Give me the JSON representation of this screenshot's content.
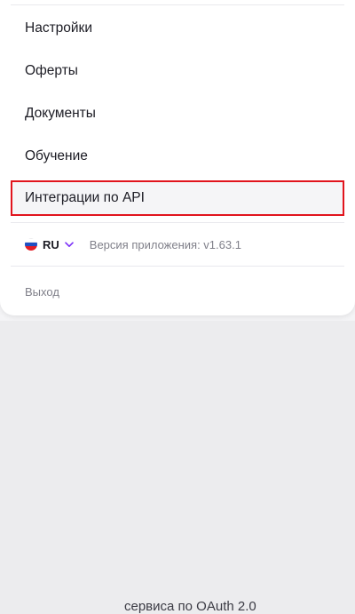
{
  "menu": {
    "items": [
      {
        "label": "Настройки"
      },
      {
        "label": "Оферты"
      },
      {
        "label": "Документы"
      },
      {
        "label": "Обучение"
      },
      {
        "label": "Интеграции по API"
      }
    ]
  },
  "footer": {
    "language": "RU",
    "language_icon": "ru-flag-icon",
    "version_text": "Версия приложения: v1.63.1",
    "logout_label": "Выход"
  },
  "background": {
    "partial_text": "сервиса по OAuth 2.0"
  },
  "colors": {
    "highlight_border": "#e1141d",
    "chevron": "#7b2ff7"
  }
}
